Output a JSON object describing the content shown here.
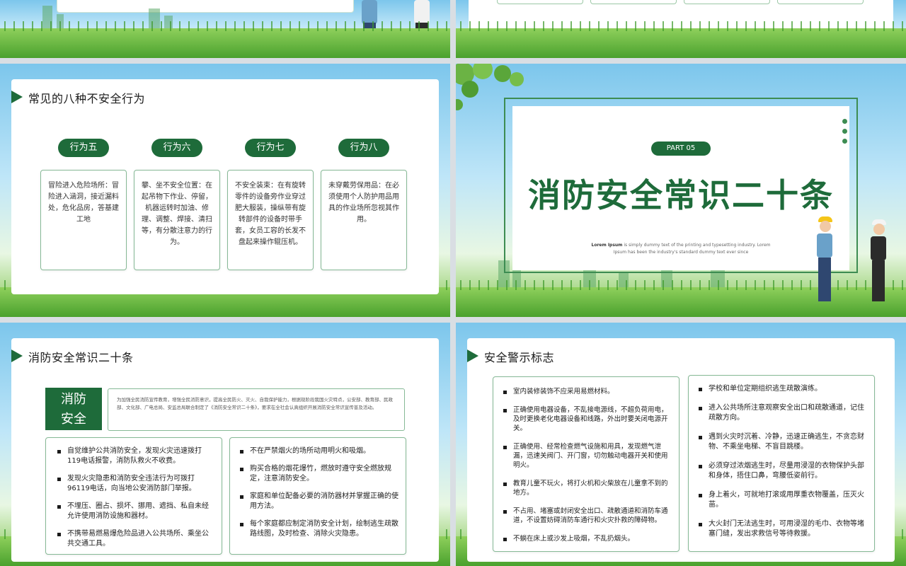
{
  "slide3": {
    "title": "常见的八种不安全行为",
    "behaviors": [
      {
        "label": "行为五",
        "text": "冒险进入危险场所：冒险进入涵洞，接近漏料处，危化品房，答基建工地"
      },
      {
        "label": "行为六",
        "text": "攀、坐不安全位置：在起吊物下作业、停留，机器运转时加油、修理、调整、焊接、清扫等，有分散注意力的行为。"
      },
      {
        "label": "行为七",
        "text": "不安全装束：在有旋转零件的设备旁作业穿过肥大服装，操纵带有旋转部件的设备时带手套，女员工容的长发不盘起来操作辊压机。"
      },
      {
        "label": "行为八",
        "text": "未穿戴劳保用品：在必须使用个人防护用品用具的作业场所忽视其作用。"
      }
    ]
  },
  "slide4": {
    "part": "PART  05",
    "title": "消防安全常识二十条",
    "lorem_bold": "Lorem Ipsum",
    "lorem_rest": " is simply dummy text of the printing and typesetting industry. Lorem Ipsum has been the industry's standard dummy text ever since"
  },
  "slide5": {
    "title": "消防安全常识二十条",
    "tag_line1": "消防",
    "tag_line2": "安全",
    "intro": "为加强全民消防宣传教育，增强全民消防意识，提高全民防火、灭火、自我保护能力，根据现阶段我国火灾特点，公安部、教育部、民政部、文化部、广电总局、安监总局联合制定了《消防安全常识二十条》，要求在全社会认真组织开展消防安全常识宣传普及活动。",
    "left_items": [
      "自觉维护公共消防安全，发现火灾迅速拨打119电话报警，消防队救火不收费。",
      "发现火灾隐患和消防安全违法行为可拨打96119电话，向当地公安消防部门举报。",
      "不埋压、圈占、损坏、挪用、遮挡、私自未经允许使用消防设施和器材。",
      "不携带易燃易爆危险品进入公共场所、乘坐公共交通工具。"
    ],
    "right_items": [
      "不在严禁烟火的场所动用明火和吸烟。",
      "购买合格的烟花爆竹，燃放时遵守安全燃放规定，注意消防安全。",
      "家庭和单位配备必要的消防器材并掌握正确的使用方法。",
      "每个家庭都应制定消防安全计划，绘制逃生疏散路线图，及时检查、消除火灾隐患。"
    ]
  },
  "slide6": {
    "title": "安全警示标志",
    "left_items": [
      "室内装修装饰不应采用易燃材料。",
      "正确使用电器设备，不乱接电源线，不超负荷用电，及时更换老化电器设备和线路，外出时要关闭电源开关。",
      "正确使用、经常检查燃气设施和用具，发现燃气泄漏，迅速关阀门、开门窗，切勿触动电器开关和使用明火。",
      "教育儿童不玩火，将打火机和火柴放在儿童拿不到的地方。",
      "不占用、堵塞或封闭安全出口、疏散通道和消防车通道，不设置妨碍消防车通行和火灾扑救的障碍物。",
      "不躺在床上或沙发上吸烟，不乱扔烟头。"
    ],
    "right_items": [
      "学校和单位定期组织逃生疏散演练。",
      "进入公共场所注意观察安全出口和疏散通道，记住疏散方向。",
      "遇到火灾时沉着、冷静，迅速正确逃生，不贪恋财物、不乘坐电梯、不盲目跳楼。",
      "必须穿过浓烟逃生时，尽量用浸湿的衣物保护头部和身体，捂住口鼻，弯腰低姿前行。",
      "身上着火，可就地打滚或用厚重衣物覆盖，压灭火苗。",
      "大火封门无法逃生时，可用浸湿的毛巾、衣物等堵塞门缝，发出求救信号等待救援。"
    ]
  },
  "colors": {
    "primary_green": "#1e6b3a",
    "card_border": "#86b996"
  }
}
